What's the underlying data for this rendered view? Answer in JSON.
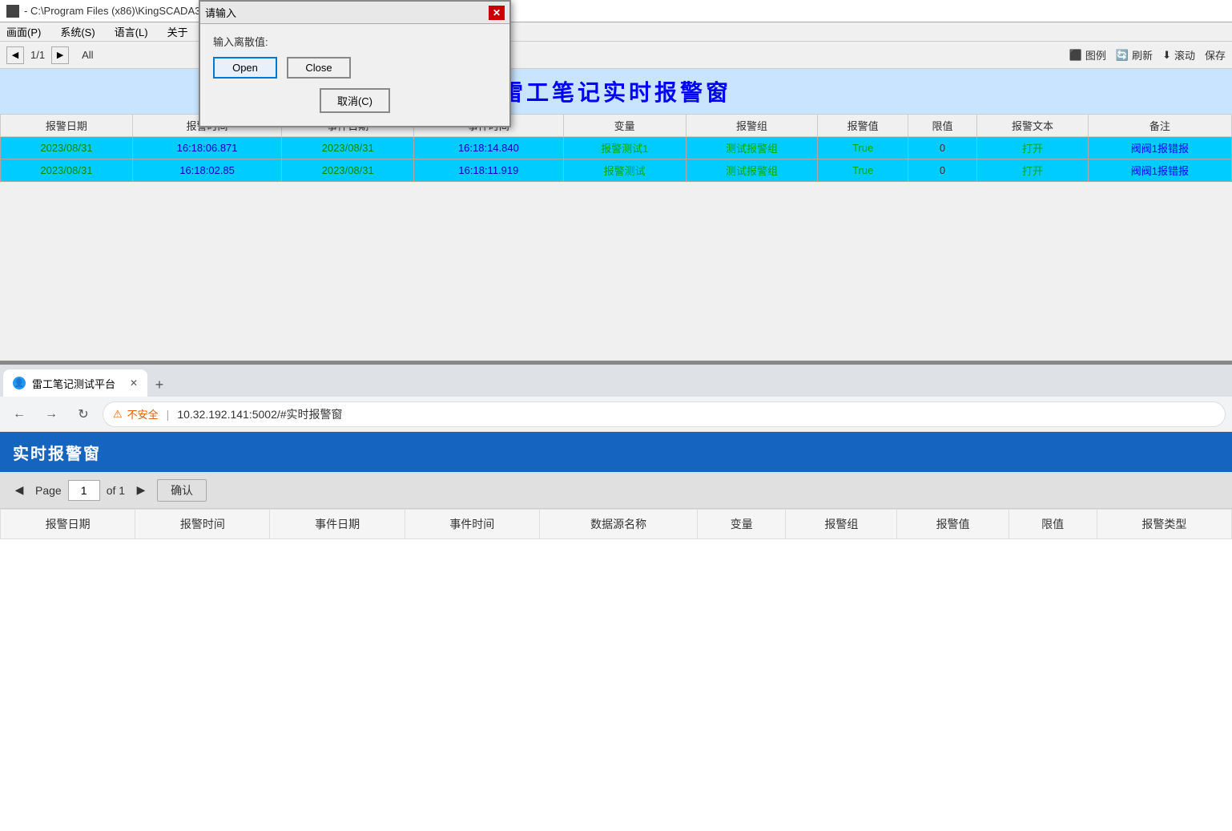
{
  "scada": {
    "title": "- C:\\Program Files (x86)\\KingSCADA3.7\\My Projects\\KS_WHN",
    "menu": {
      "items": [
        "画面(P)",
        "系统(S)",
        "语言(L)",
        "关于"
      ]
    },
    "navbar": {
      "page": "1/1",
      "all_label": "All",
      "legend_btn": "图例",
      "refresh_btn": "刷新",
      "scroll_btn": "滚动",
      "save_btn": "保存"
    },
    "alarm_window": {
      "title": "雷工笔记实时报警窗",
      "columns": [
        "报警日期",
        "报警时间",
        "事件日期",
        "事件时间",
        "变量",
        "报警组",
        "报警值",
        "限值",
        "报警文本",
        "备注"
      ],
      "rows": [
        {
          "alarm_date": "2023/08/31",
          "alarm_time": "16:18:06.871",
          "event_date": "2023/08/31",
          "event_time": "16:18:14.840",
          "variable": "报警测试1",
          "group": "测试报警组",
          "value": "True",
          "limit": "0",
          "text": "打开",
          "note": "阀阀1报错报"
        },
        {
          "alarm_date": "2023/08/31",
          "alarm_time": "16:18:02.85",
          "event_date": "2023/08/31",
          "event_time": "16:18:11.919",
          "variable": "报警测试",
          "group": "测试报警组",
          "value": "True",
          "limit": "0",
          "text": "打开",
          "note": "阀阀1报错报"
        }
      ]
    }
  },
  "dialog": {
    "title": "请输入",
    "label": "输入离散值:",
    "open_btn": "Open",
    "close_btn": "Close",
    "cancel_btn": "取消(C)"
  },
  "browser": {
    "tab_label": "雷工笔记测试平台",
    "add_tab": "+",
    "address": "10.32.192.141:5002/#实时报警窗",
    "security_label": "不安全",
    "separator": "|",
    "web_page": {
      "header_title": "实时报警窗",
      "pagination": {
        "page_label": "Page",
        "page_value": "1",
        "of_label": "of 1",
        "confirm_btn": "确认"
      },
      "columns": [
        "报警日期",
        "报警时间",
        "事件日期",
        "事件时间",
        "数据源名称",
        "变量",
        "报警组",
        "报警值",
        "限值",
        "报警类型"
      ]
    }
  }
}
